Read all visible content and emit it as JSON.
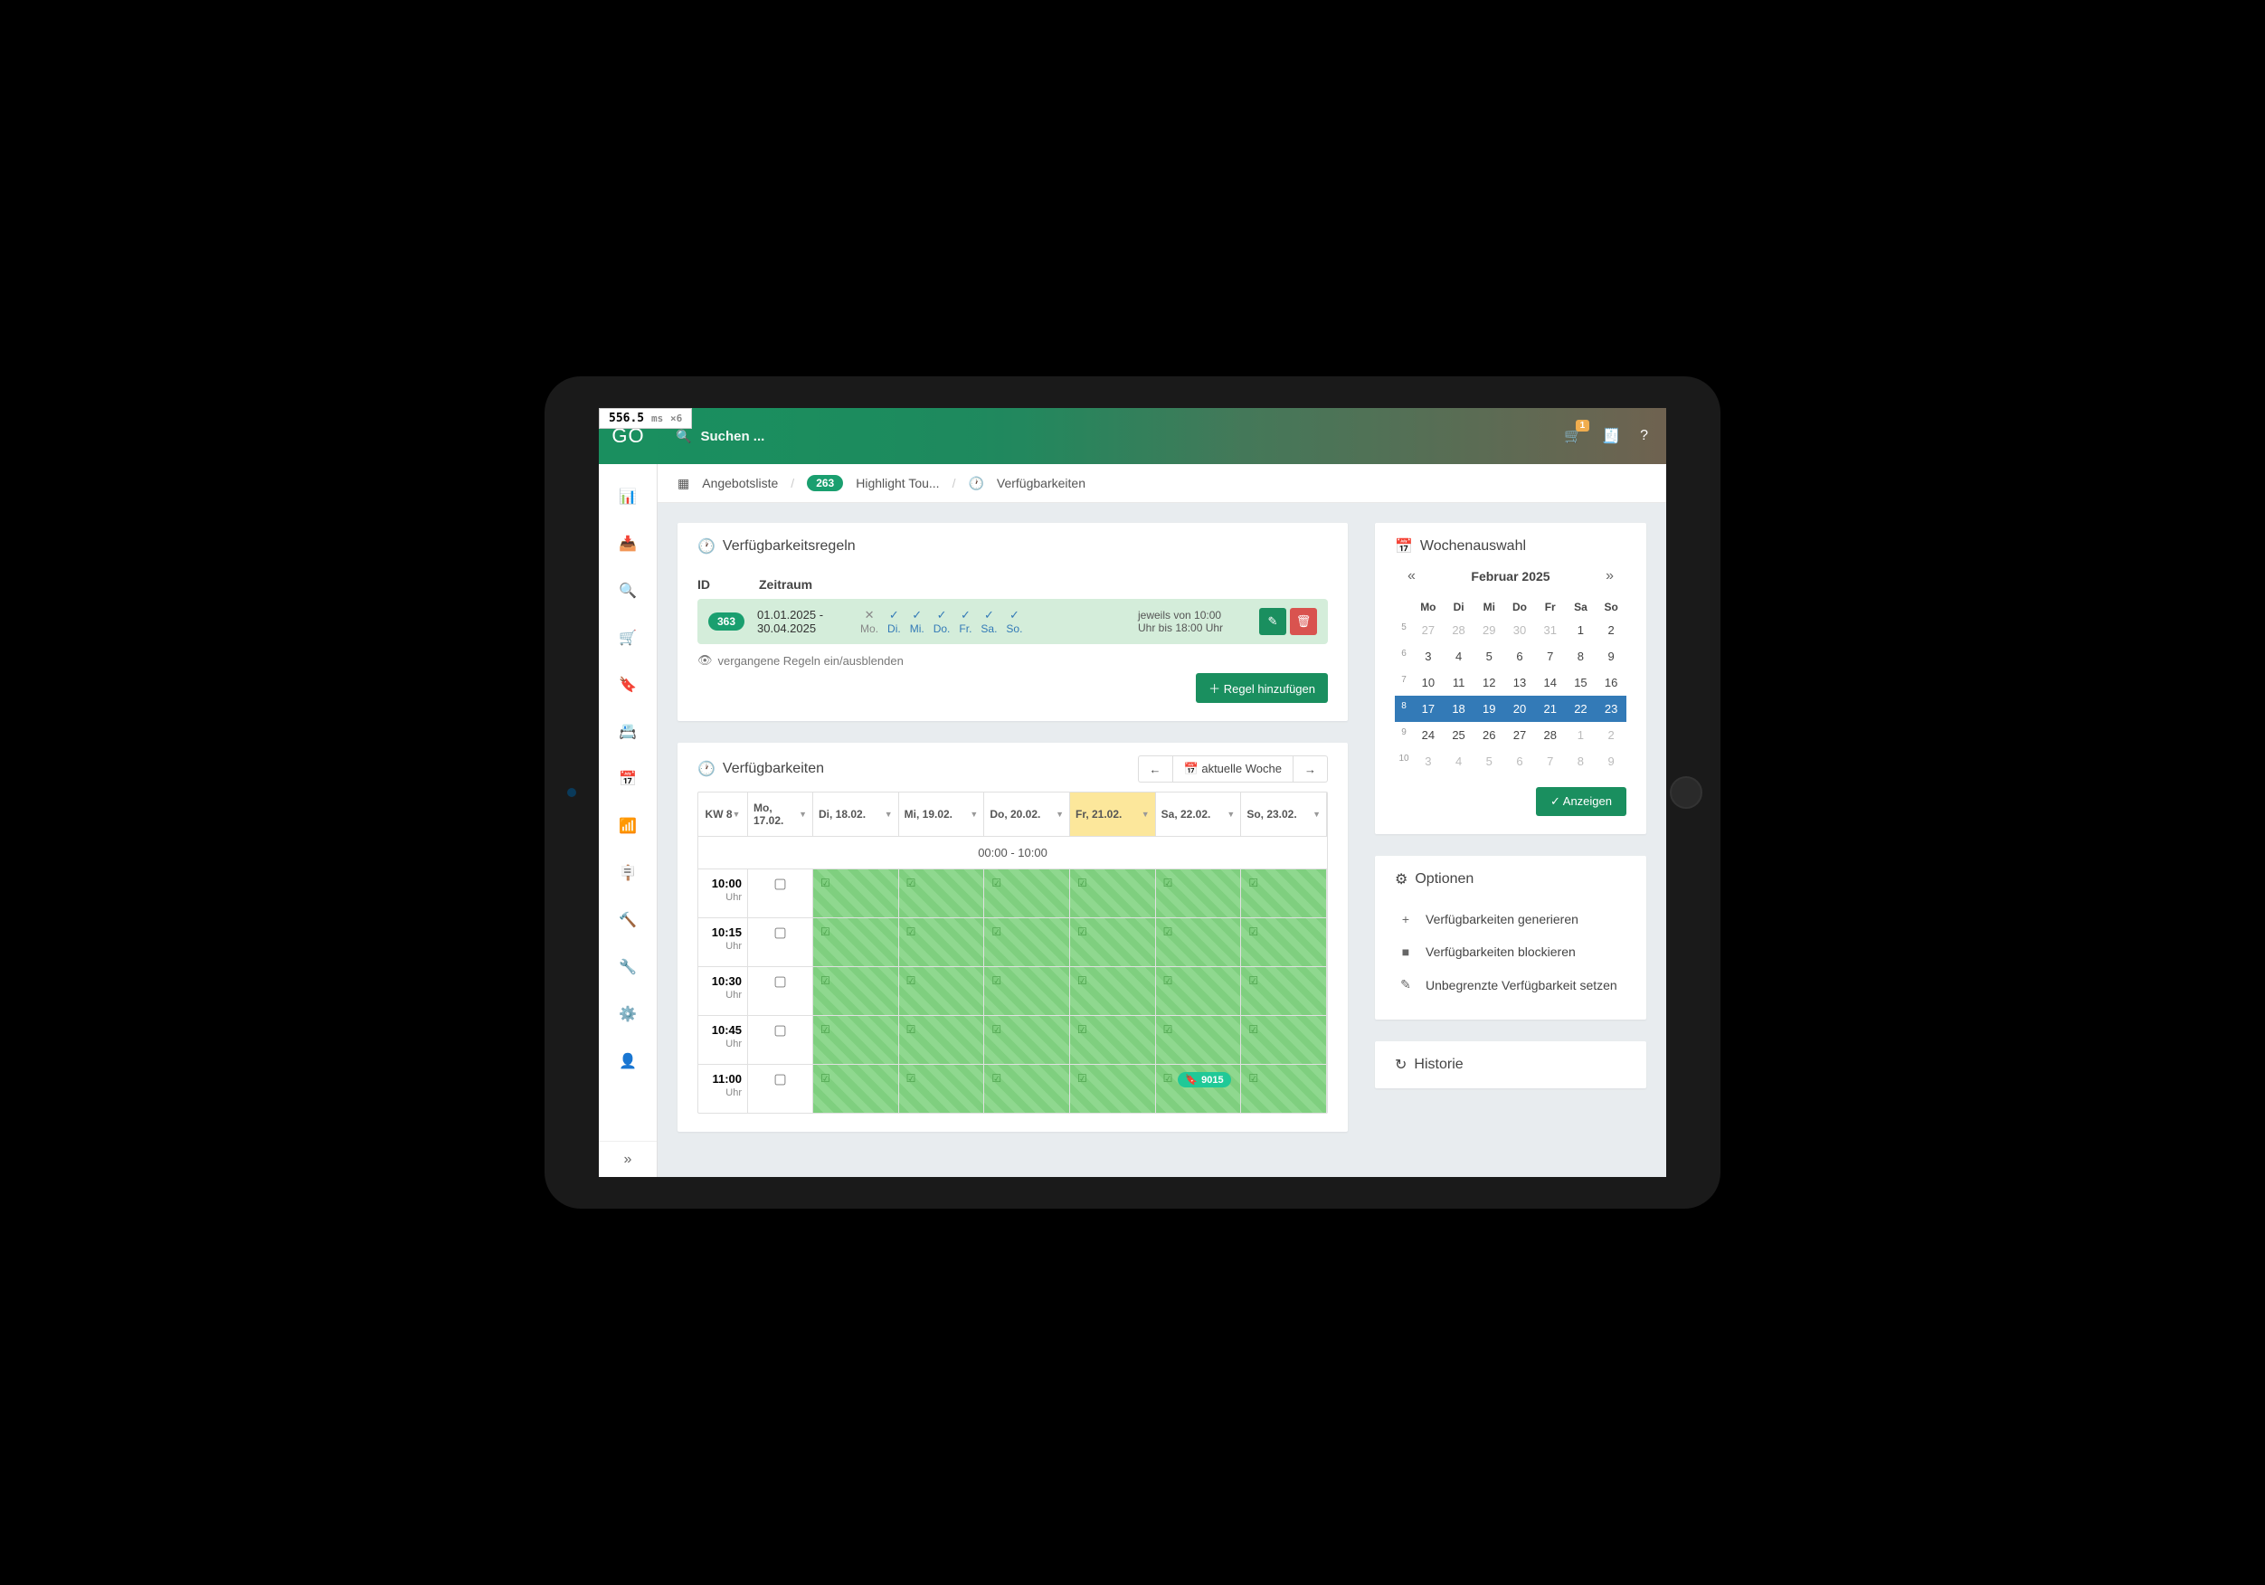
{
  "perf": {
    "value": "556.5",
    "unit": "ms",
    "mult": "×6"
  },
  "header": {
    "logo": "GO",
    "search_placeholder": "Suchen ...",
    "cart_badge": "1"
  },
  "breadcrumb": {
    "list_label": "Angebotsliste",
    "item_badge": "263",
    "item_label": "Highlight Tou...",
    "current": "Verfügbarkeiten"
  },
  "rules_panel": {
    "title": "Verfügbarkeitsregeln",
    "col_id": "ID",
    "col_period": "Zeitraum",
    "rule": {
      "id": "363",
      "from": "01.01.2025 -",
      "to": "30.04.2025",
      "days": [
        {
          "abbr": "Mo.",
          "on": false
        },
        {
          "abbr": "Di.",
          "on": true
        },
        {
          "abbr": "Mi.",
          "on": true
        },
        {
          "abbr": "Do.",
          "on": true
        },
        {
          "abbr": "Fr.",
          "on": true
        },
        {
          "abbr": "Sa.",
          "on": true
        },
        {
          "abbr": "So.",
          "on": true
        }
      ],
      "time_text1": "jeweils von 10:00",
      "time_text2": "Uhr bis 18:00 Uhr"
    },
    "toggle_past": "vergangene Regeln ein/ausblenden",
    "add_rule": "Regel hinzufügen"
  },
  "avail_panel": {
    "title": "Verfügbarkeiten",
    "current_week_btn": "aktuelle Woche",
    "week_label": "KW 8",
    "days": [
      "Mo, 17.02.",
      "Di, 18.02.",
      "Mi, 19.02.",
      "Do, 20.02.",
      "Fr, 21.02.",
      "Sa, 22.02.",
      "So, 23.02."
    ],
    "highlight_day_index": 4,
    "spacer_label": "00:00 - 10:00",
    "time_unit": "Uhr",
    "times": [
      "10:00",
      "10:15",
      "10:30",
      "10:45",
      "11:00"
    ],
    "booking_tag": "9015"
  },
  "calendar_panel": {
    "title": "Wochenauswahl",
    "month": "Februar 2025",
    "day_heads": [
      "Mo",
      "Di",
      "Mi",
      "Do",
      "Fr",
      "Sa",
      "So"
    ],
    "weeks": [
      {
        "wk": "5",
        "days": [
          {
            "d": "27",
            "m": true
          },
          {
            "d": "28",
            "m": true
          },
          {
            "d": "29",
            "m": true
          },
          {
            "d": "30",
            "m": true
          },
          {
            "d": "31",
            "m": true
          },
          {
            "d": "1"
          },
          {
            "d": "2"
          }
        ],
        "sel": false
      },
      {
        "wk": "6",
        "days": [
          {
            "d": "3"
          },
          {
            "d": "4"
          },
          {
            "d": "5"
          },
          {
            "d": "6"
          },
          {
            "d": "7"
          },
          {
            "d": "8"
          },
          {
            "d": "9"
          }
        ],
        "sel": false
      },
      {
        "wk": "7",
        "days": [
          {
            "d": "10"
          },
          {
            "d": "11"
          },
          {
            "d": "12"
          },
          {
            "d": "13"
          },
          {
            "d": "14"
          },
          {
            "d": "15"
          },
          {
            "d": "16"
          }
        ],
        "sel": false
      },
      {
        "wk": "8",
        "days": [
          {
            "d": "17"
          },
          {
            "d": "18"
          },
          {
            "d": "19"
          },
          {
            "d": "20"
          },
          {
            "d": "21"
          },
          {
            "d": "22"
          },
          {
            "d": "23"
          }
        ],
        "sel": true
      },
      {
        "wk": "9",
        "days": [
          {
            "d": "24"
          },
          {
            "d": "25"
          },
          {
            "d": "26"
          },
          {
            "d": "27"
          },
          {
            "d": "28"
          },
          {
            "d": "1",
            "m": true
          },
          {
            "d": "2",
            "m": true
          }
        ],
        "sel": false
      },
      {
        "wk": "10",
        "days": [
          {
            "d": "3",
            "m": true
          },
          {
            "d": "4",
            "m": true
          },
          {
            "d": "5",
            "m": true
          },
          {
            "d": "6",
            "m": true
          },
          {
            "d": "7",
            "m": true
          },
          {
            "d": "8",
            "m": true
          },
          {
            "d": "9",
            "m": true
          }
        ],
        "sel": false
      }
    ],
    "show_btn": "Anzeigen"
  },
  "options_panel": {
    "title": "Optionen",
    "items": [
      {
        "icon": "+",
        "label": "Verfügbarkeiten generieren"
      },
      {
        "icon": "■",
        "label": "Verfügbarkeiten blockieren"
      },
      {
        "icon": "✎",
        "label": "Unbegrenzte Verfügbarkeit setzen"
      }
    ]
  },
  "history_panel": {
    "title": "Historie"
  }
}
